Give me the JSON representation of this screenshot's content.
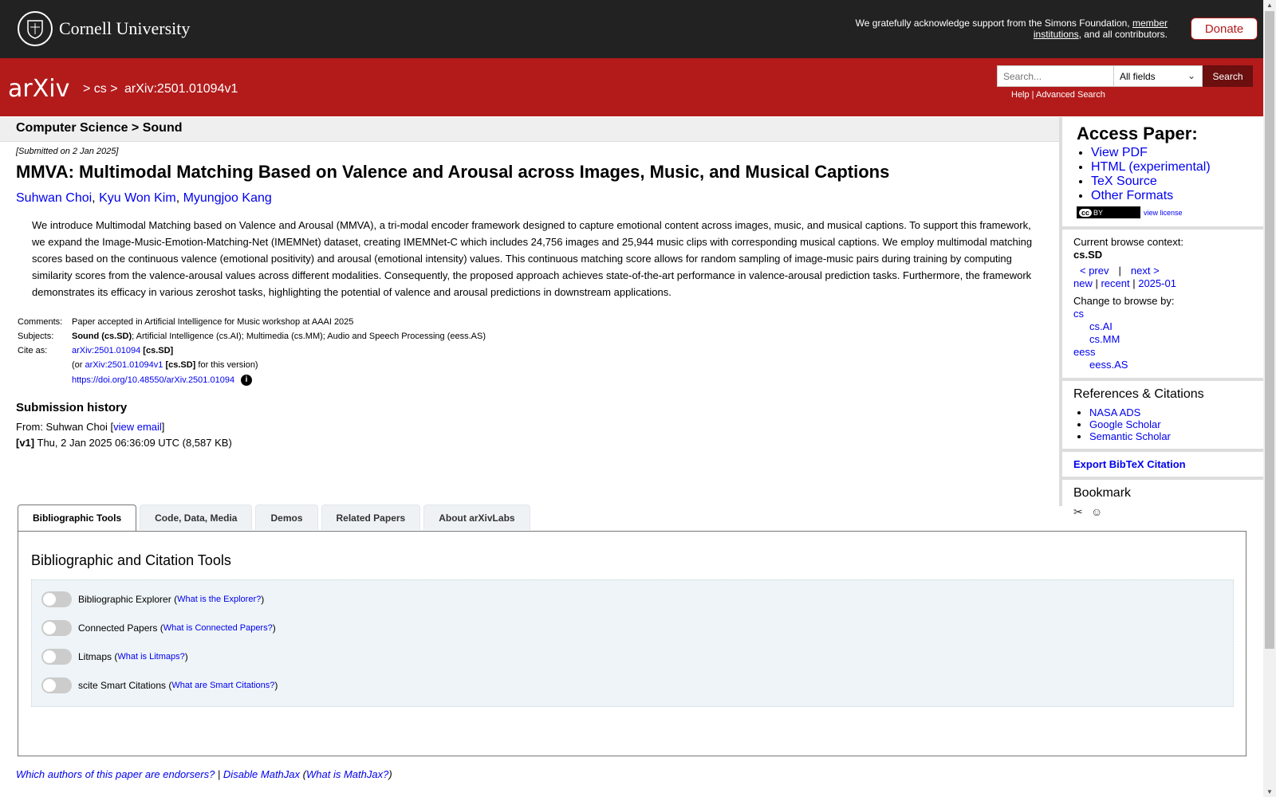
{
  "header": {
    "university": "Cornell University",
    "support_prefix": "We gratefully acknowledge support from the Simons Foundation,",
    "support_link": "member institutions",
    "support_suffix": ", and all contributors.",
    "donate_label": "Donate"
  },
  "nav": {
    "logo_text": "arXiv",
    "crumbs": [
      "> cs >",
      "arXiv:2501.01094v1"
    ],
    "search_placeholder": "Search...",
    "search_field_selected": "All fields",
    "search_button": "Search",
    "help_label": "Help",
    "advanced_label": "Advanced Search"
  },
  "subject_heading": "Computer Science > Sound",
  "paper": {
    "submitted": "[Submitted on 2 Jan 2025]",
    "title": "MMVA: Multimodal Matching Based on Valence and Arousal across Images, Music, and Musical Captions",
    "authors": [
      "Suhwan Choi",
      "Kyu Won Kim",
      "Myungjoo Kang"
    ],
    "abstract": "We introduce Multimodal Matching based on Valence and Arousal (MMVA), a tri-modal encoder framework designed to capture emotional content across images, music, and musical captions. To support this framework, we expand the Image-Music-Emotion-Matching-Net (IMEMNet) dataset, creating IMEMNet-C which includes 24,756 images and 25,944 music clips with corresponding musical captions. We employ multimodal matching scores based on the continuous valence (emotional positivity) and arousal (emotional intensity) values. This continuous matching score allows for random sampling of image-music pairs during training by computing similarity scores from the valence-arousal values across different modalities. Consequently, the proposed approach achieves state-of-the-art performance in valence-arousal prediction tasks. Furthermore, the framework demonstrates its efficacy in various zeroshot tasks, highlighting the potential of valence and arousal predictions in downstream applications.",
    "comments_label": "Comments:",
    "comments": "Paper accepted in Artificial Intelligence for Music workshop at AAAI 2025",
    "subjects_label": "Subjects:",
    "subjects_primary": "Sound (cs.SD)",
    "subjects_rest": "; Artificial Intelligence (cs.AI); Multimedia (cs.MM); Audio and Speech Processing (eess.AS)",
    "cite_label": "Cite as:",
    "cite_id": "arXiv:2501.01094",
    "cite_tag": "[cs.SD]",
    "cite_version_prefix": "(or",
    "cite_version_id": "arXiv:2501.01094v1",
    "cite_version_tag": "[cs.SD]",
    "cite_version_suffix": "for this version)",
    "doi": "https://doi.org/10.48550/arXiv.2501.01094"
  },
  "history": {
    "heading": "Submission history",
    "from_prefix": "From: Suhwan Choi [",
    "view_email": "view email",
    "from_suffix": "]",
    "version_tag": "[v1]",
    "version_info": "Thu, 2 Jan 2025 06:36:09 UTC (8,587 KB)"
  },
  "sidebar": {
    "access_heading": "Access Paper:",
    "access_links": [
      "View PDF",
      "HTML (experimental)",
      "TeX Source",
      "Other Formats"
    ],
    "view_license": "view license",
    "browse_context_label": "Current browse context:",
    "browse_context": "cs.SD",
    "prev": "< prev",
    "sep": "|",
    "next": "next >",
    "new": "new",
    "recent": "recent",
    "month": "2025-01",
    "change_label": "Change to browse by:",
    "browse_cs": "cs",
    "browse_cs_ai": "cs.AI",
    "browse_cs_mm": "cs.MM",
    "browse_eess": "eess",
    "browse_eess_as": "eess.AS",
    "refs_heading": "References & Citations",
    "refs_links": [
      "NASA ADS",
      "Google Scholar",
      "Semantic Scholar"
    ],
    "export_bibtex": "Export BibTeX Citation",
    "bookmark_heading": "Bookmark"
  },
  "tabs": {
    "items": [
      "Bibliographic Tools",
      "Code, Data, Media",
      "Demos",
      "Related Papers",
      "About arXivLabs"
    ],
    "panel_heading": "Bibliographic and Citation Tools",
    "tools": [
      {
        "name": "Bibliographic Explorer",
        "help": "What is the Explorer?"
      },
      {
        "name": "Connected Papers",
        "help": "What is Connected Papers?"
      },
      {
        "name": "Litmaps",
        "help": "What is Litmaps?"
      },
      {
        "name": "scite Smart Citations",
        "help": "What are Smart Citations?"
      }
    ]
  },
  "footer": {
    "endorsers": "Which authors of this paper are endorsers?",
    "disable_mathjax": "Disable MathJax",
    "what_mathjax": "What is MathJax?"
  },
  "colors": {
    "brand_red": "#b31b1b",
    "top_bar": "#222222",
    "link": "#0000ee"
  }
}
